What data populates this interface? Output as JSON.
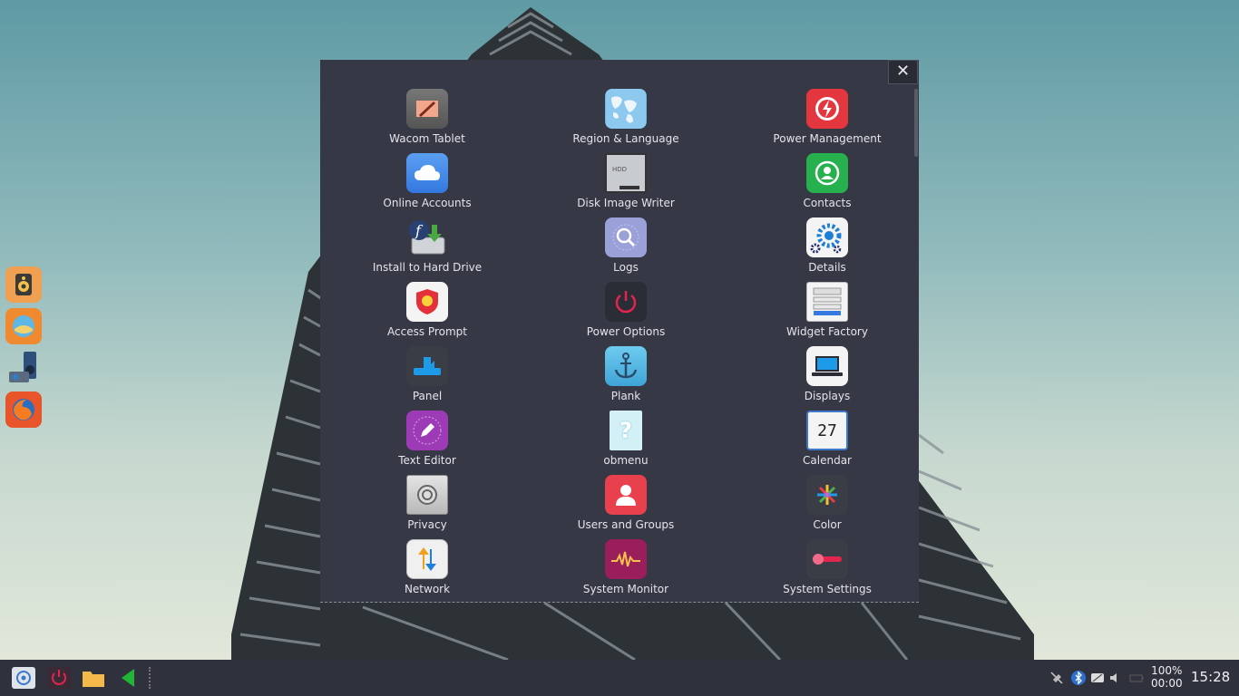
{
  "launcher": {
    "close_label": "✕",
    "apps": [
      {
        "label": "Wacom Tablet",
        "icon": "wacom-tablet-icon"
      },
      {
        "label": "Region & Language",
        "icon": "globe-icon"
      },
      {
        "label": "Power Management",
        "icon": "power-management-icon"
      },
      {
        "label": "Online Accounts",
        "icon": "cloud-icon"
      },
      {
        "label": "Disk Image Writer",
        "icon": "hdd-icon"
      },
      {
        "label": "Contacts",
        "icon": "contacts-icon"
      },
      {
        "label": "Install to Hard Drive",
        "icon": "install-icon"
      },
      {
        "label": "Logs",
        "icon": "magnifier-icon"
      },
      {
        "label": "Details",
        "icon": "gear-icon"
      },
      {
        "label": "Access Prompt",
        "icon": "shield-icon"
      },
      {
        "label": "Power Options",
        "icon": "power-icon"
      },
      {
        "label": "Widget Factory",
        "icon": "widget-factory-icon"
      },
      {
        "label": "Panel",
        "icon": "panel-icon"
      },
      {
        "label": "Plank",
        "icon": "anchor-icon"
      },
      {
        "label": "Displays",
        "icon": "laptop-icon"
      },
      {
        "label": "Text Editor",
        "icon": "pen-icon"
      },
      {
        "label": "obmenu",
        "icon": "question-icon"
      },
      {
        "label": "Calendar",
        "icon": "calendar-icon"
      },
      {
        "label": "Privacy",
        "icon": "safe-icon"
      },
      {
        "label": "Users and Groups",
        "icon": "user-icon"
      },
      {
        "label": "Color",
        "icon": "color-icon"
      },
      {
        "label": "Network",
        "icon": "network-arrows-icon"
      },
      {
        "label": "System Monitor",
        "icon": "waveform-icon"
      },
      {
        "label": "System Settings",
        "icon": "toggle-icon"
      }
    ]
  },
  "hdd_text": "HDD",
  "calendar_day": "27",
  "dock": [
    "speaker-app-icon",
    "browser-app-icon",
    "audio-player-icon",
    "firefox-icon"
  ],
  "taskbar": {
    "battery_percent": "100%",
    "battery_time": "00:00",
    "clock": "15:28"
  },
  "colors": {
    "launcher_bg": "#363845",
    "taskbar_bg": "#2f313c",
    "accent_red": "#e33d4b"
  }
}
